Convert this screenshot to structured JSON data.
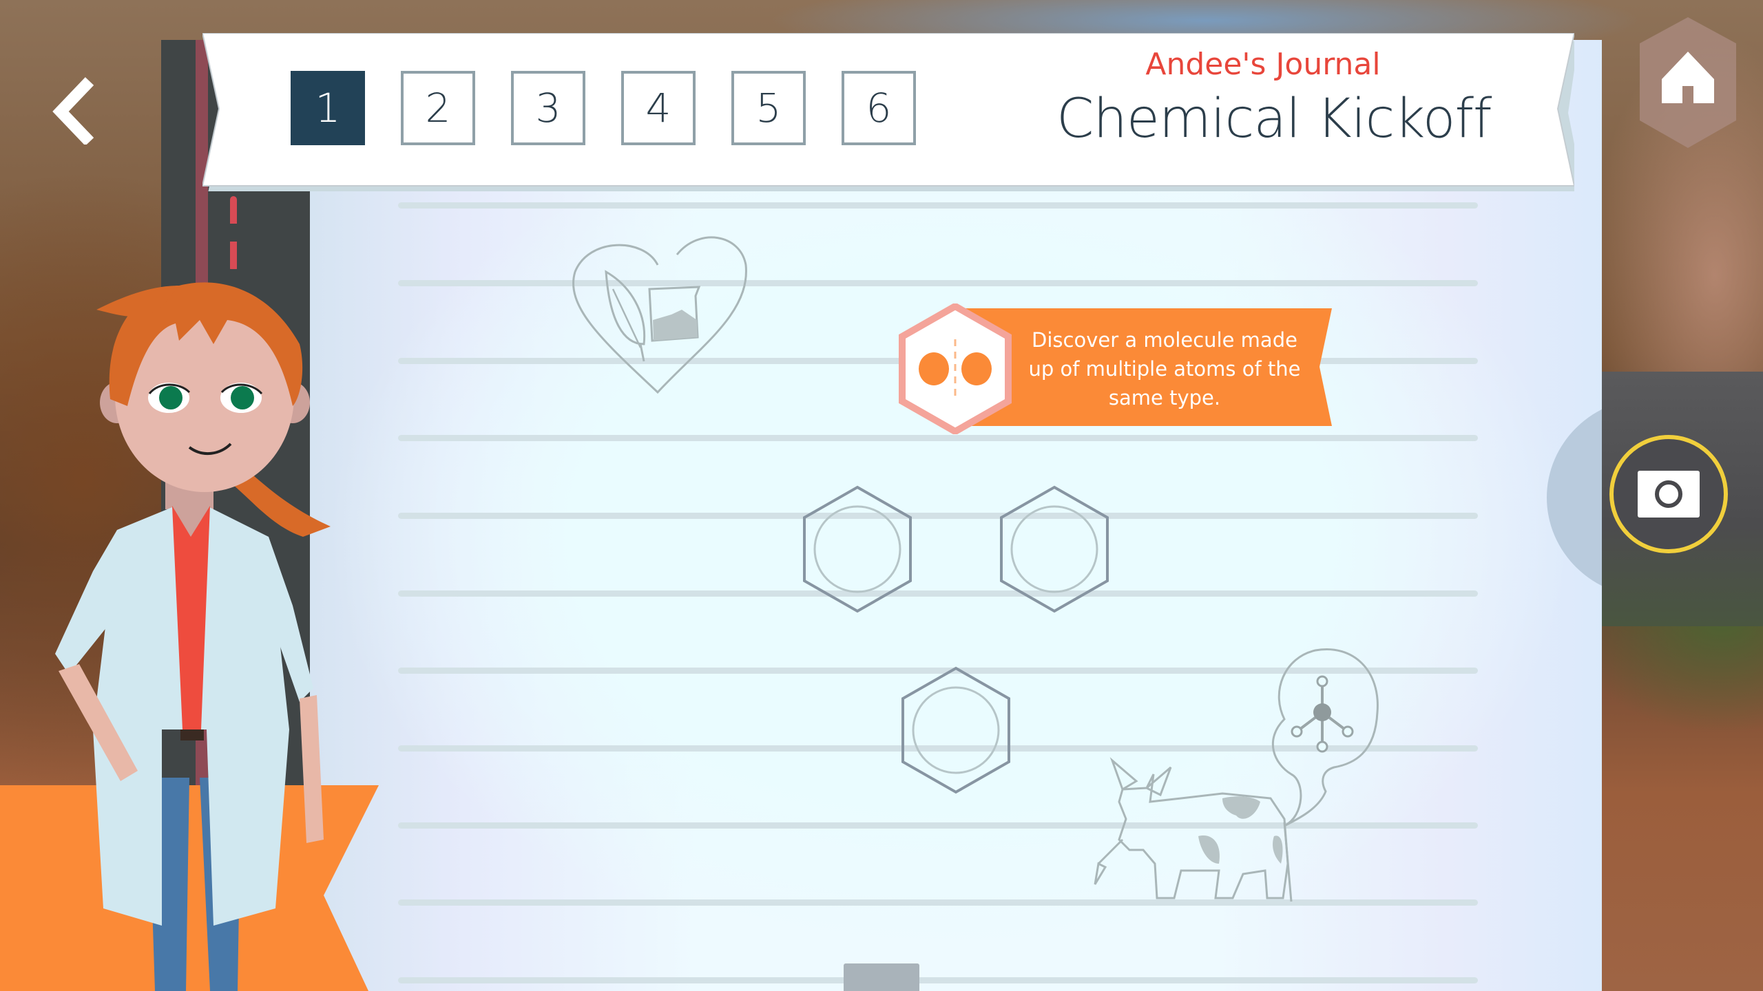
{
  "header": {
    "journal_owner": "Andee's Journal",
    "page_title": "Chemical Kickoff",
    "page_tabs": [
      {
        "label": "1",
        "active": true
      },
      {
        "label": "2",
        "active": false
      },
      {
        "label": "3",
        "active": false
      },
      {
        "label": "4",
        "active": false
      },
      {
        "label": "5",
        "active": false
      },
      {
        "label": "6",
        "active": false
      }
    ]
  },
  "navigation": {
    "back_icon": "chevron-left-icon",
    "home_icon": "home-icon",
    "camera_icon": "camera-icon"
  },
  "objective": {
    "icon": "diatomic-molecule-icon",
    "text": "Discover a molecule made up of multiple atoms of the same type."
  },
  "molecule_slots": [
    {
      "state": "empty"
    },
    {
      "state": "empty"
    },
    {
      "state": "empty"
    }
  ],
  "sketches": [
    "heart-leaf-beaker-sketch",
    "cow-methane-sketch"
  ],
  "character": "andee-scientist",
  "colors": {
    "accent_orange": "#fb8a37",
    "title_red": "#e8463b",
    "tab_active": "#224257",
    "camera_ring": "#f1cf3c",
    "badge_pink": "#f4a49a"
  }
}
